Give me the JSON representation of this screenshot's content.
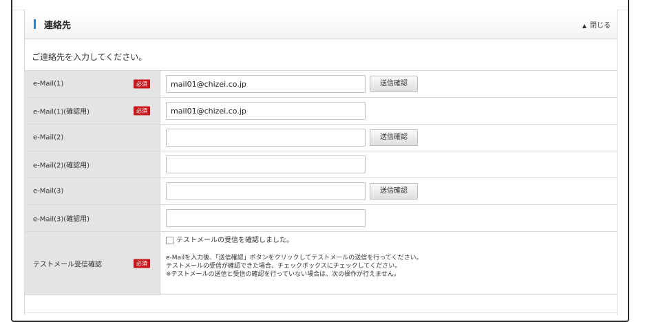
{
  "section": {
    "title": "連絡先",
    "close_label": "閉じる",
    "close_icon": "▲",
    "intro": "ご連絡先を入力してください。"
  },
  "required_label": "必須",
  "send_button_label": "送信確認",
  "rows": [
    {
      "label": "e-Mail(1)",
      "value": "mail01@chizei.co.jp"
    },
    {
      "label": "e-Mail(1)(確認用)",
      "value": "mail01@chizei.co.jp"
    },
    {
      "label": "e-Mail(2)",
      "value": ""
    },
    {
      "label": "e-Mail(2)(確認用)",
      "value": ""
    },
    {
      "label": "e-Mail(3)",
      "value": ""
    },
    {
      "label": "e-Mail(3)(確認用)",
      "value": ""
    }
  ],
  "test_mail": {
    "label": "テストメール受信確認",
    "checkbox_label": "テストメールの受信を確認しました。",
    "notes": [
      "e-Mailを入力後、「送信確認」ボタンをクリックしてテストメールの送信を行ってください。",
      "テストメールの受信が確認できた場合、チェックボックスにチェックしてください。",
      "※テストメールの送信と受信の確認を行っていない場合は、次の操作が行えません。"
    ]
  },
  "colors": {
    "accent": "#2f83c4",
    "required": "#c8161d",
    "label_bg": "#e4e4e4"
  }
}
